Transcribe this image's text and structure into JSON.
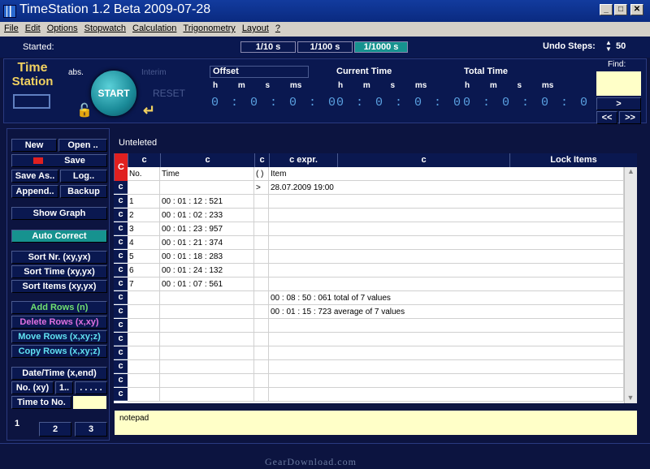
{
  "window": {
    "title": "TimeStation 1.2 Beta 2009-07-28",
    "min": "_",
    "max": "□",
    "close": "✕"
  },
  "menu": [
    "File",
    "Edit",
    "Options",
    "Stopwatch",
    "Calculation",
    "Trigonometry",
    "Layout",
    "?"
  ],
  "strip": {
    "started": "Started:",
    "res": [
      "1/10 s",
      "1/100 s",
      "1/1000 s"
    ],
    "undo_label": "Undo Steps:",
    "undo_value": "50",
    "undo_arrows": "▲▼"
  },
  "panel": {
    "logo1": "Time",
    "logo2": "Station",
    "abs": "abs.",
    "interim": "Interim",
    "start": "START",
    "reset": "RESET",
    "groups": [
      {
        "label": "Offset"
      },
      {
        "label": "Current Time"
      },
      {
        "label": "Total Time"
      }
    ],
    "hms": "h m s ms",
    "digits": "0 : 0 : 0 :  0",
    "find_label": "Find:",
    "find_value": "",
    "next": ">",
    "prev_all": "<<",
    "next_all": ">>"
  },
  "sidebar": {
    "new": "New",
    "open": "Open ..",
    "save": "Save",
    "save_as": "Save As..",
    "log": "Log..",
    "append": "Append..",
    "backup": "Backup",
    "show_graph": "Show Graph",
    "auto_correct": "Auto Correct",
    "sort_nr": "Sort Nr. (xy,yx)",
    "sort_time": "Sort Time (xy,yx)",
    "sort_items": "Sort Items (xy,yx)",
    "add_rows": "Add Rows (n)",
    "delete_rows": "Delete Rows (x,xy)",
    "move_rows": "Move Rows (x,xy;z)",
    "copy_rows": "Copy Rows (x,xy;z)",
    "date_time": "Date/Time (x,end)",
    "no_xy": "No. (xy)",
    "one": "1..",
    "dots": ". . . . .",
    "time_to_no": "Time to No.",
    "pages": [
      "1",
      "2",
      "3"
    ]
  },
  "grid": {
    "title": "Unteleted",
    "corner": "C",
    "col_c": [
      "c",
      "c",
      "c",
      "c  expr.",
      "c"
    ],
    "lock_items": "Lock Items",
    "headers": [
      "No.",
      "Time",
      "( )",
      "Item"
    ],
    "row_btn": "c",
    "rows": [
      {
        "no": "",
        "time": "",
        "br": ">",
        "item": "28.07.2009   19:00"
      },
      {
        "no": "1",
        "time": "00 : 01 : 12 : 521",
        "br": "",
        "item": ""
      },
      {
        "no": "2",
        "time": "00 : 01 : 02 : 233",
        "br": "",
        "item": ""
      },
      {
        "no": "3",
        "time": "00 : 01 : 23 : 957",
        "br": "",
        "item": ""
      },
      {
        "no": "4",
        "time": "00 : 01 : 21 : 374",
        "br": "",
        "item": ""
      },
      {
        "no": "5",
        "time": "00 : 01 : 18 : 283",
        "br": "",
        "item": ""
      },
      {
        "no": "6",
        "time": "00 : 01 : 24 : 132",
        "br": "",
        "item": ""
      },
      {
        "no": "7",
        "time": "00 : 01 : 07 : 561",
        "br": "",
        "item": ""
      },
      {
        "no": "",
        "time": "",
        "br": "",
        "item": "00 : 08 : 50 : 061    total of 7 values"
      },
      {
        "no": "",
        "time": "",
        "br": "",
        "item": "00 : 01 : 15 : 723    average of 7 values"
      },
      {
        "no": "",
        "time": "",
        "br": "",
        "item": ""
      },
      {
        "no": "",
        "time": "",
        "br": "",
        "item": ""
      },
      {
        "no": "",
        "time": "",
        "br": "",
        "item": ""
      },
      {
        "no": "",
        "time": "",
        "br": "",
        "item": ""
      },
      {
        "no": "",
        "time": "",
        "br": "",
        "item": ""
      },
      {
        "no": "",
        "time": "",
        "br": "",
        "item": ""
      }
    ]
  },
  "notepad": "notepad",
  "watermark": "GearDownload.com"
}
